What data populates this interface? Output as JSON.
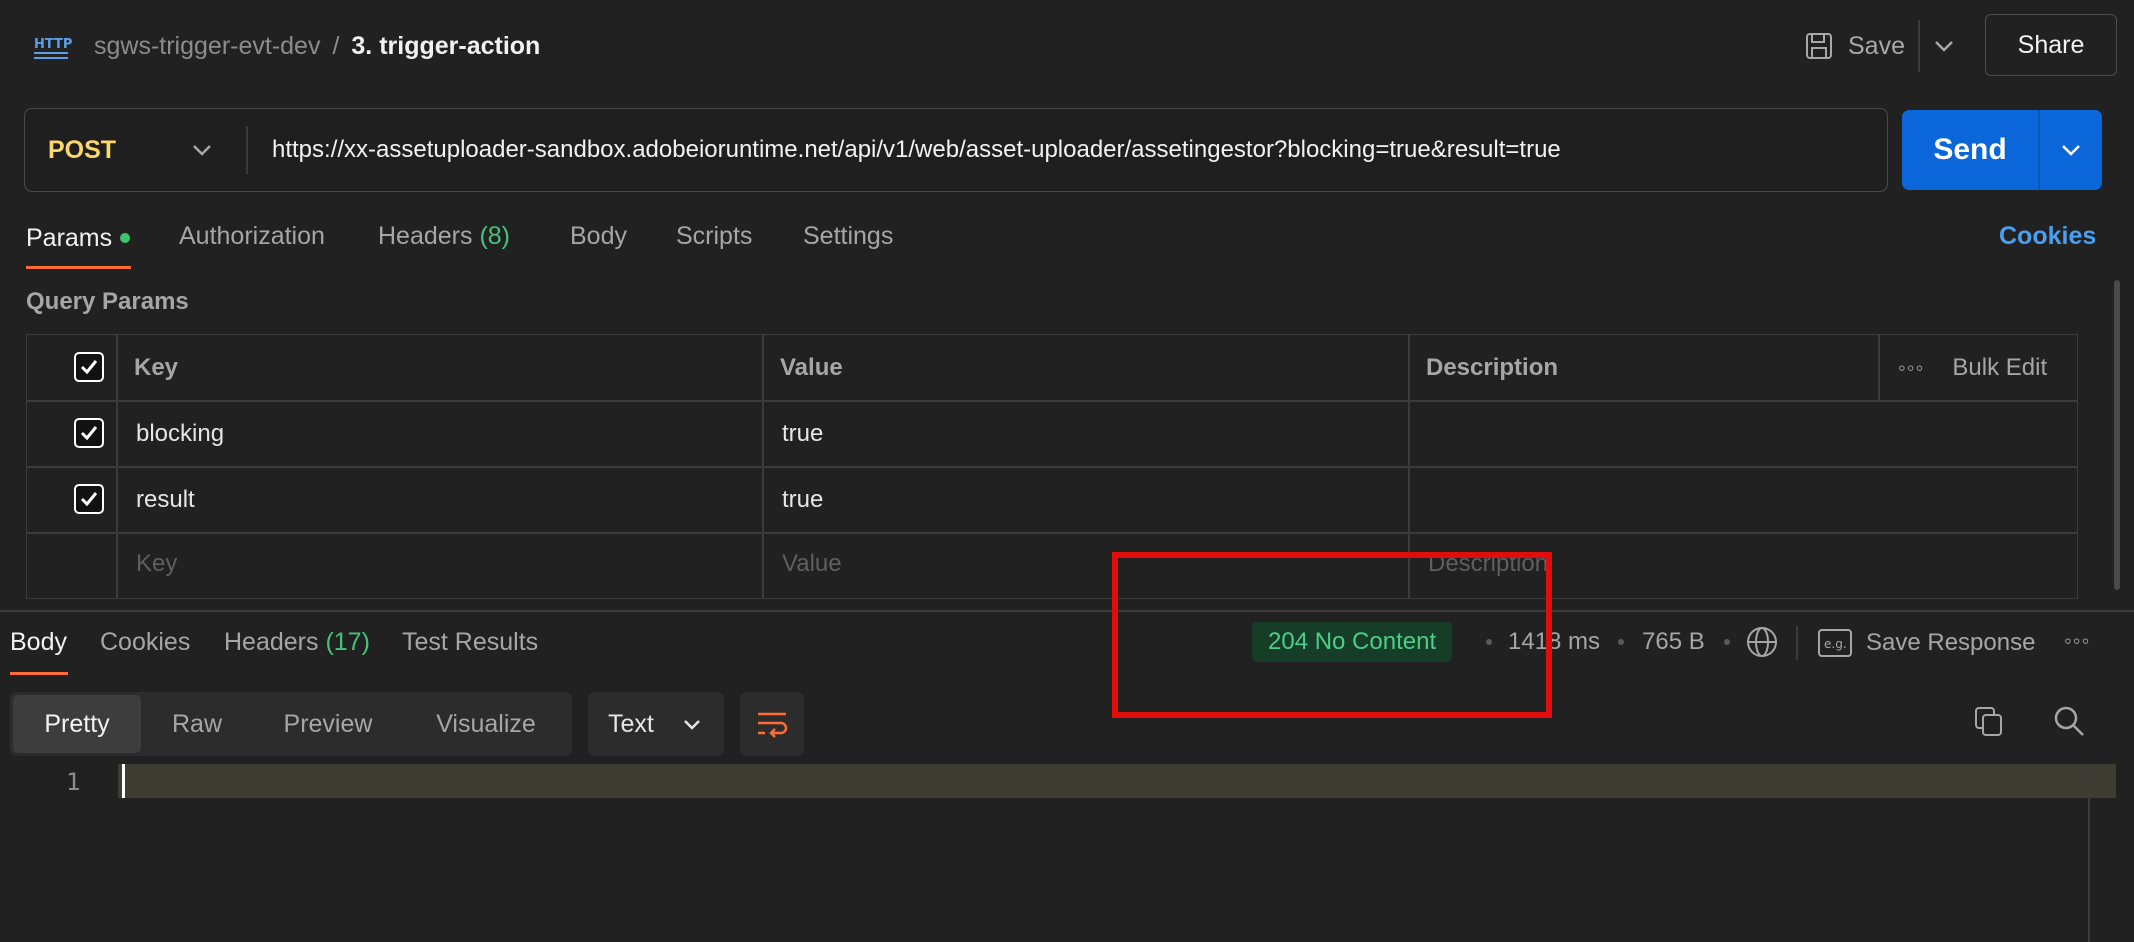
{
  "header": {
    "breadcrumb_parent": "sgws-trigger-evt-dev",
    "breadcrumb_separator": "/",
    "breadcrumb_current": "3. trigger-action",
    "save_label": "Save",
    "share_label": "Share",
    "request_icon_text": "HTTP"
  },
  "request": {
    "method": "POST",
    "url": "https://xx-assetuploader-sandbox.adobeioruntime.net/api/v1/web/asset-uploader/assetingestor?blocking=true&result=true",
    "send_label": "Send"
  },
  "request_tabs": {
    "params": "Params",
    "authorization": "Authorization",
    "headers": "Headers",
    "headers_count": "(8)",
    "body": "Body",
    "scripts": "Scripts",
    "settings": "Settings",
    "cookies": "Cookies"
  },
  "query_params": {
    "title": "Query Params",
    "columns": {
      "key": "Key",
      "value": "Value",
      "description": "Description",
      "bulk_edit": "Bulk Edit"
    },
    "rows": [
      {
        "key": "blocking",
        "value": "true",
        "description": "",
        "checked": true
      },
      {
        "key": "result",
        "value": "true",
        "description": "",
        "checked": true
      }
    ],
    "placeholder": {
      "key": "Key",
      "value": "Value",
      "description": "Description"
    }
  },
  "response_tabs": {
    "body": "Body",
    "cookies": "Cookies",
    "headers": "Headers",
    "headers_count": "(17)",
    "test_results": "Test Results"
  },
  "response_meta": {
    "status": "204 No Content",
    "time": "1418 ms",
    "size": "765 B",
    "save_response": "Save Response",
    "save_icon_text": "e.g."
  },
  "body_view": {
    "modes": [
      "Pretty",
      "Raw",
      "Preview",
      "Visualize"
    ],
    "active_mode": "Pretty",
    "format": "Text",
    "line_number": "1"
  },
  "colors": {
    "accent_orange": "#ff6c37",
    "send_blue": "#0b66d9",
    "status_green": "#4bcf88",
    "method_yellow": "#fcd86b",
    "annotation_red": "#e10d0d"
  }
}
